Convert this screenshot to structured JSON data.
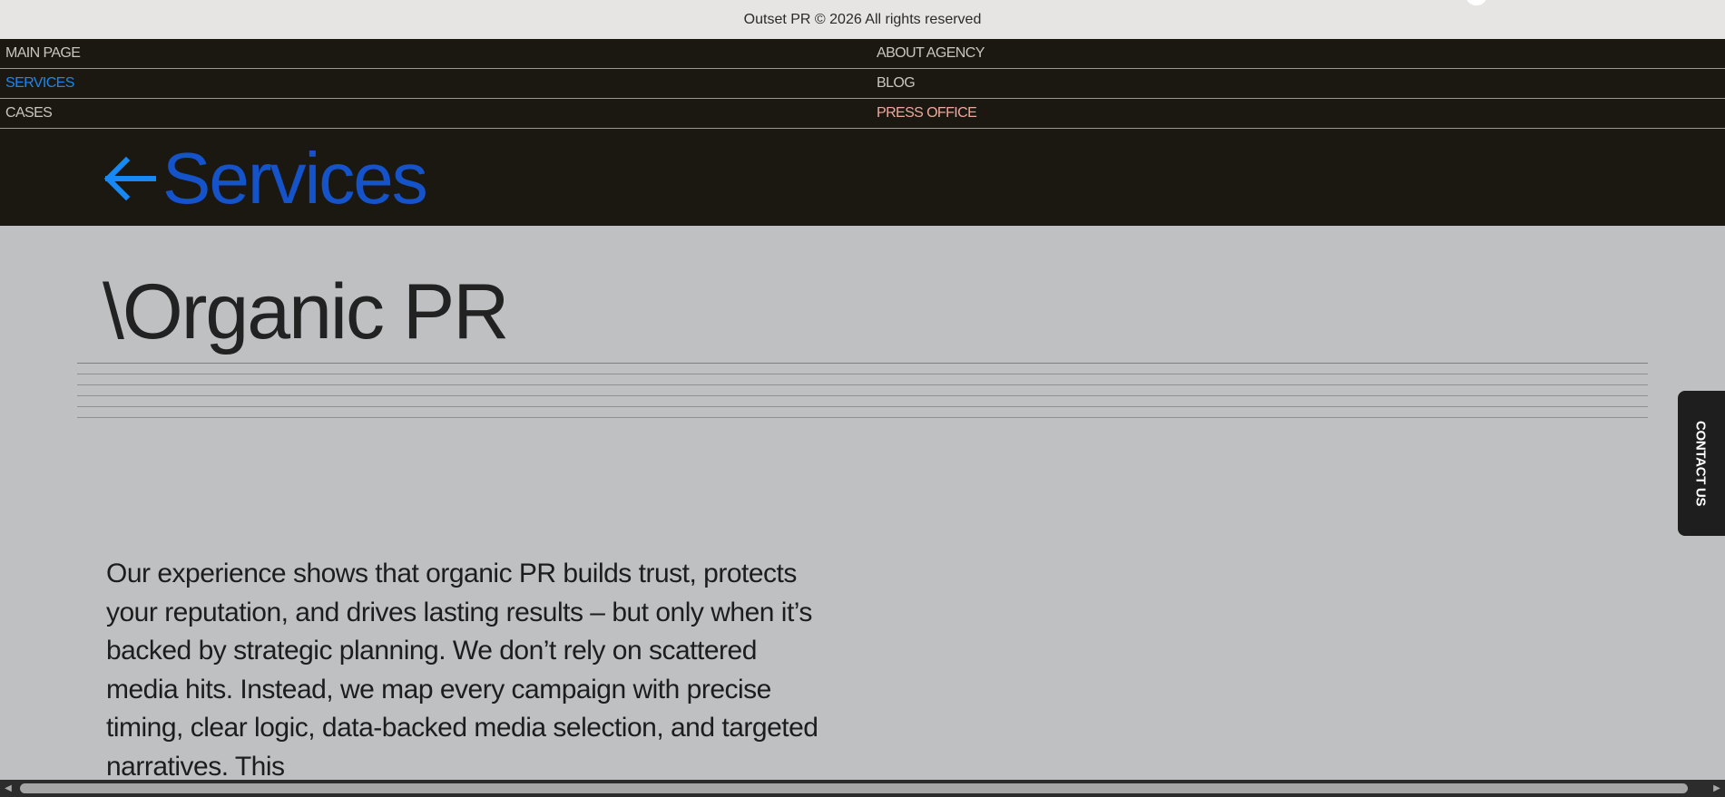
{
  "footer": {
    "copyright": "Outset PR © 2026 All rights reserved"
  },
  "nav": {
    "left": [
      "MAIN PAGE",
      "SERVICES",
      "CASES"
    ],
    "right": [
      "ABOUT AGENCY",
      "BLOG",
      "PRESS OFFICE"
    ],
    "active": "SERVICES"
  },
  "back": {
    "arrow": "←",
    "label": "Services",
    "icon": "arrow-left-icon"
  },
  "page": {
    "title": "\\Organic PR",
    "intro": "Our experience shows that organic PR builds trust, protects your reputation, and drives lasting results – but only when it’s backed by strategic planning. We don’t rely on scattered media hits. Instead, we map every campaign with precise timing, clear logic, data-backed media selection, and targeted narratives. This"
  },
  "contact_tab": {
    "label": "CONTACT US"
  },
  "colors": {
    "nav_bg": "#1b1812",
    "page_bg": "#bfc0c2",
    "accent_blue": "#1453c9",
    "active_link": "#1a86f0",
    "press_office": "#eea89c"
  },
  "scrollbar": {
    "left_icon": "chevron-left-icon",
    "right_icon": "chevron-right-icon"
  }
}
